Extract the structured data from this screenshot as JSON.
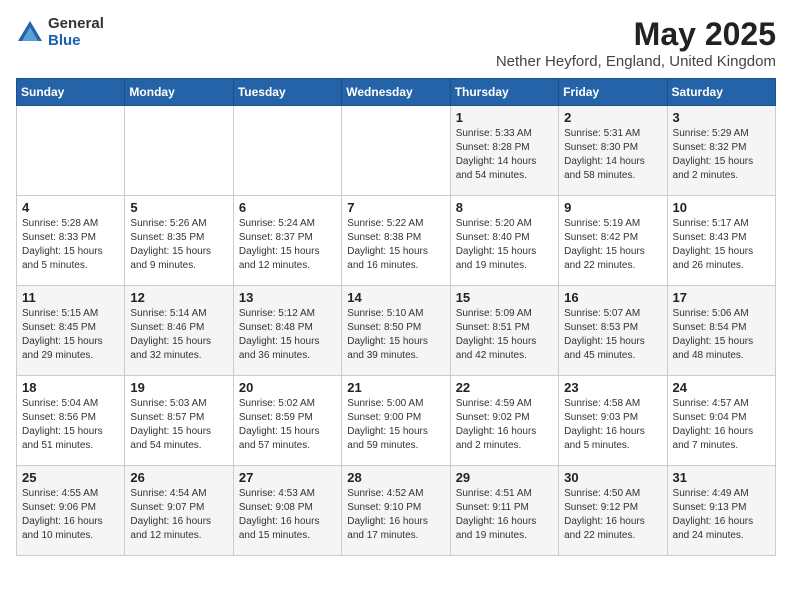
{
  "logo": {
    "general": "General",
    "blue": "Blue"
  },
  "header": {
    "month": "May 2025",
    "location": "Nether Heyford, England, United Kingdom"
  },
  "days_of_week": [
    "Sunday",
    "Monday",
    "Tuesday",
    "Wednesday",
    "Thursday",
    "Friday",
    "Saturday"
  ],
  "weeks": [
    [
      {
        "day": "",
        "info": ""
      },
      {
        "day": "",
        "info": ""
      },
      {
        "day": "",
        "info": ""
      },
      {
        "day": "",
        "info": ""
      },
      {
        "day": "1",
        "info": "Sunrise: 5:33 AM\nSunset: 8:28 PM\nDaylight: 14 hours\nand 54 minutes."
      },
      {
        "day": "2",
        "info": "Sunrise: 5:31 AM\nSunset: 8:30 PM\nDaylight: 14 hours\nand 58 minutes."
      },
      {
        "day": "3",
        "info": "Sunrise: 5:29 AM\nSunset: 8:32 PM\nDaylight: 15 hours\nand 2 minutes."
      }
    ],
    [
      {
        "day": "4",
        "info": "Sunrise: 5:28 AM\nSunset: 8:33 PM\nDaylight: 15 hours\nand 5 minutes."
      },
      {
        "day": "5",
        "info": "Sunrise: 5:26 AM\nSunset: 8:35 PM\nDaylight: 15 hours\nand 9 minutes."
      },
      {
        "day": "6",
        "info": "Sunrise: 5:24 AM\nSunset: 8:37 PM\nDaylight: 15 hours\nand 12 minutes."
      },
      {
        "day": "7",
        "info": "Sunrise: 5:22 AM\nSunset: 8:38 PM\nDaylight: 15 hours\nand 16 minutes."
      },
      {
        "day": "8",
        "info": "Sunrise: 5:20 AM\nSunset: 8:40 PM\nDaylight: 15 hours\nand 19 minutes."
      },
      {
        "day": "9",
        "info": "Sunrise: 5:19 AM\nSunset: 8:42 PM\nDaylight: 15 hours\nand 22 minutes."
      },
      {
        "day": "10",
        "info": "Sunrise: 5:17 AM\nSunset: 8:43 PM\nDaylight: 15 hours\nand 26 minutes."
      }
    ],
    [
      {
        "day": "11",
        "info": "Sunrise: 5:15 AM\nSunset: 8:45 PM\nDaylight: 15 hours\nand 29 minutes."
      },
      {
        "day": "12",
        "info": "Sunrise: 5:14 AM\nSunset: 8:46 PM\nDaylight: 15 hours\nand 32 minutes."
      },
      {
        "day": "13",
        "info": "Sunrise: 5:12 AM\nSunset: 8:48 PM\nDaylight: 15 hours\nand 36 minutes."
      },
      {
        "day": "14",
        "info": "Sunrise: 5:10 AM\nSunset: 8:50 PM\nDaylight: 15 hours\nand 39 minutes."
      },
      {
        "day": "15",
        "info": "Sunrise: 5:09 AM\nSunset: 8:51 PM\nDaylight: 15 hours\nand 42 minutes."
      },
      {
        "day": "16",
        "info": "Sunrise: 5:07 AM\nSunset: 8:53 PM\nDaylight: 15 hours\nand 45 minutes."
      },
      {
        "day": "17",
        "info": "Sunrise: 5:06 AM\nSunset: 8:54 PM\nDaylight: 15 hours\nand 48 minutes."
      }
    ],
    [
      {
        "day": "18",
        "info": "Sunrise: 5:04 AM\nSunset: 8:56 PM\nDaylight: 15 hours\nand 51 minutes."
      },
      {
        "day": "19",
        "info": "Sunrise: 5:03 AM\nSunset: 8:57 PM\nDaylight: 15 hours\nand 54 minutes."
      },
      {
        "day": "20",
        "info": "Sunrise: 5:02 AM\nSunset: 8:59 PM\nDaylight: 15 hours\nand 57 minutes."
      },
      {
        "day": "21",
        "info": "Sunrise: 5:00 AM\nSunset: 9:00 PM\nDaylight: 15 hours\nand 59 minutes."
      },
      {
        "day": "22",
        "info": "Sunrise: 4:59 AM\nSunset: 9:02 PM\nDaylight: 16 hours\nand 2 minutes."
      },
      {
        "day": "23",
        "info": "Sunrise: 4:58 AM\nSunset: 9:03 PM\nDaylight: 16 hours\nand 5 minutes."
      },
      {
        "day": "24",
        "info": "Sunrise: 4:57 AM\nSunset: 9:04 PM\nDaylight: 16 hours\nand 7 minutes."
      }
    ],
    [
      {
        "day": "25",
        "info": "Sunrise: 4:55 AM\nSunset: 9:06 PM\nDaylight: 16 hours\nand 10 minutes."
      },
      {
        "day": "26",
        "info": "Sunrise: 4:54 AM\nSunset: 9:07 PM\nDaylight: 16 hours\nand 12 minutes."
      },
      {
        "day": "27",
        "info": "Sunrise: 4:53 AM\nSunset: 9:08 PM\nDaylight: 16 hours\nand 15 minutes."
      },
      {
        "day": "28",
        "info": "Sunrise: 4:52 AM\nSunset: 9:10 PM\nDaylight: 16 hours\nand 17 minutes."
      },
      {
        "day": "29",
        "info": "Sunrise: 4:51 AM\nSunset: 9:11 PM\nDaylight: 16 hours\nand 19 minutes."
      },
      {
        "day": "30",
        "info": "Sunrise: 4:50 AM\nSunset: 9:12 PM\nDaylight: 16 hours\nand 22 minutes."
      },
      {
        "day": "31",
        "info": "Sunrise: 4:49 AM\nSunset: 9:13 PM\nDaylight: 16 hours\nand 24 minutes."
      }
    ]
  ]
}
